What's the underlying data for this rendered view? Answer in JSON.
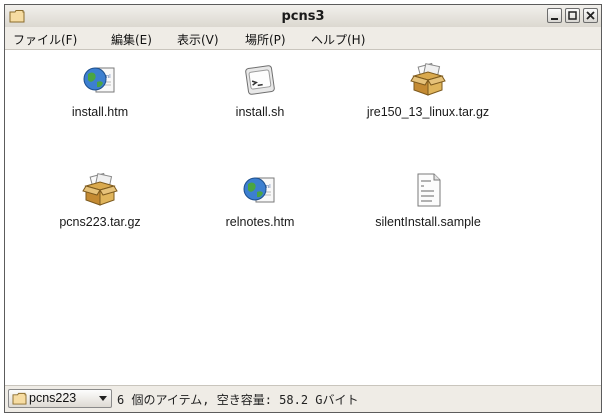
{
  "window": {
    "title": "pcns3"
  },
  "menu": [
    {
      "label": "ファイル(F)"
    },
    {
      "label": "編集(E)"
    },
    {
      "label": "表示(V)"
    },
    {
      "label": "場所(P)"
    },
    {
      "label": "ヘルプ(H)"
    }
  ],
  "files": [
    {
      "name": "install.htm",
      "icon": "html-document-icon"
    },
    {
      "name": "install.sh",
      "icon": "shell-script-icon"
    },
    {
      "name": "jre150_13_linux.tar.gz",
      "icon": "archive-package-icon"
    },
    {
      "name": "pcns223.tar.gz",
      "icon": "archive-package-icon"
    },
    {
      "name": "relnotes.htm",
      "icon": "html-document-icon"
    },
    {
      "name": "silentInstall.sample",
      "icon": "text-document-icon"
    }
  ],
  "statusbar": {
    "location": "pcns223",
    "status_text": "6 個のアイテム, 空き容量: 58.2 Gバイト"
  }
}
